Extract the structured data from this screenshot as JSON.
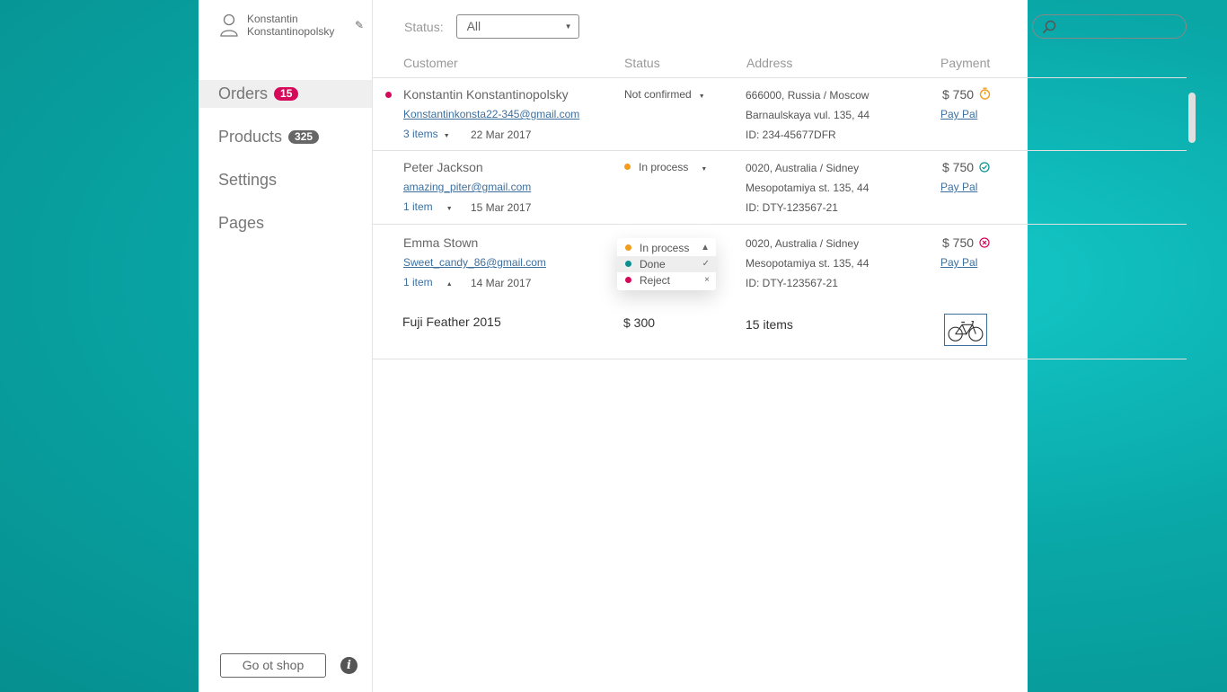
{
  "user": {
    "name": "Konstantin Konstantinopolsky"
  },
  "nav": [
    {
      "label": "Orders",
      "badge": "15"
    },
    {
      "label": "Products",
      "badge": "325"
    },
    {
      "label": "Settings"
    },
    {
      "label": "Pages"
    }
  ],
  "footer": {
    "shop_button": "Go ot shop",
    "info_glyph": "i"
  },
  "filter": {
    "label": "Status:",
    "value": "All"
  },
  "search": {
    "placeholder": ""
  },
  "columns": {
    "customer": "Customer",
    "status": "Status",
    "address": "Address",
    "payment": "Payment"
  },
  "orders": [
    {
      "name": "Konstantin Konstantinopolsky",
      "email": "Konstantinkonsta22-345@gmail.com",
      "items": "3 items",
      "date": "22 Mar 2017",
      "status": "Not confirmed",
      "address1": "666000, Russia / Moscow",
      "address2": "Barnaulskaya vul. 135, 44",
      "id": "ID: 234-45677DFR",
      "amount": "$ 750",
      "method": "Pay Pal",
      "payment_icon": "timer-icon",
      "unread": true
    },
    {
      "name": "Peter Jackson",
      "email": "amazing_piter@gmail.com",
      "items": "1 item",
      "date": "15 Mar 2017",
      "status": "In process",
      "address1": "0020, Australia / Sidney",
      "address2": "Mesopotamiya st. 135, 44",
      "id": "ID: DTY-123567-21",
      "amount": "$ 750",
      "method": "Pay Pal",
      "payment_icon": "check-circle-icon"
    },
    {
      "name": "Emma Stown",
      "email": "Sweet_candy_86@gmail.com",
      "items": "1 item",
      "date": "14 Mar 2017",
      "status": "In process",
      "address1": "0020, Australia / Sidney",
      "address2": "Mesopotamiya st. 135, 44",
      "id": "ID: DTY-123567-21",
      "amount": "$ 750",
      "method": "Pay Pal",
      "payment_icon": "x-circle-icon",
      "expanded": true,
      "dropdown": [
        {
          "label": "In process",
          "color": "#f29b1c"
        },
        {
          "label": "Done",
          "color": "#0b8f8f"
        },
        {
          "label": "Reject",
          "color": "#d6085a"
        }
      ],
      "products": [
        {
          "name": "Fuji Feather 2015",
          "price": "$ 300",
          "qty": "15 items"
        }
      ]
    }
  ],
  "colors": {
    "accent": "#d6085a",
    "link": "#3d6f9e",
    "teal": "#0b8f8f",
    "orange": "#f29b1c"
  }
}
